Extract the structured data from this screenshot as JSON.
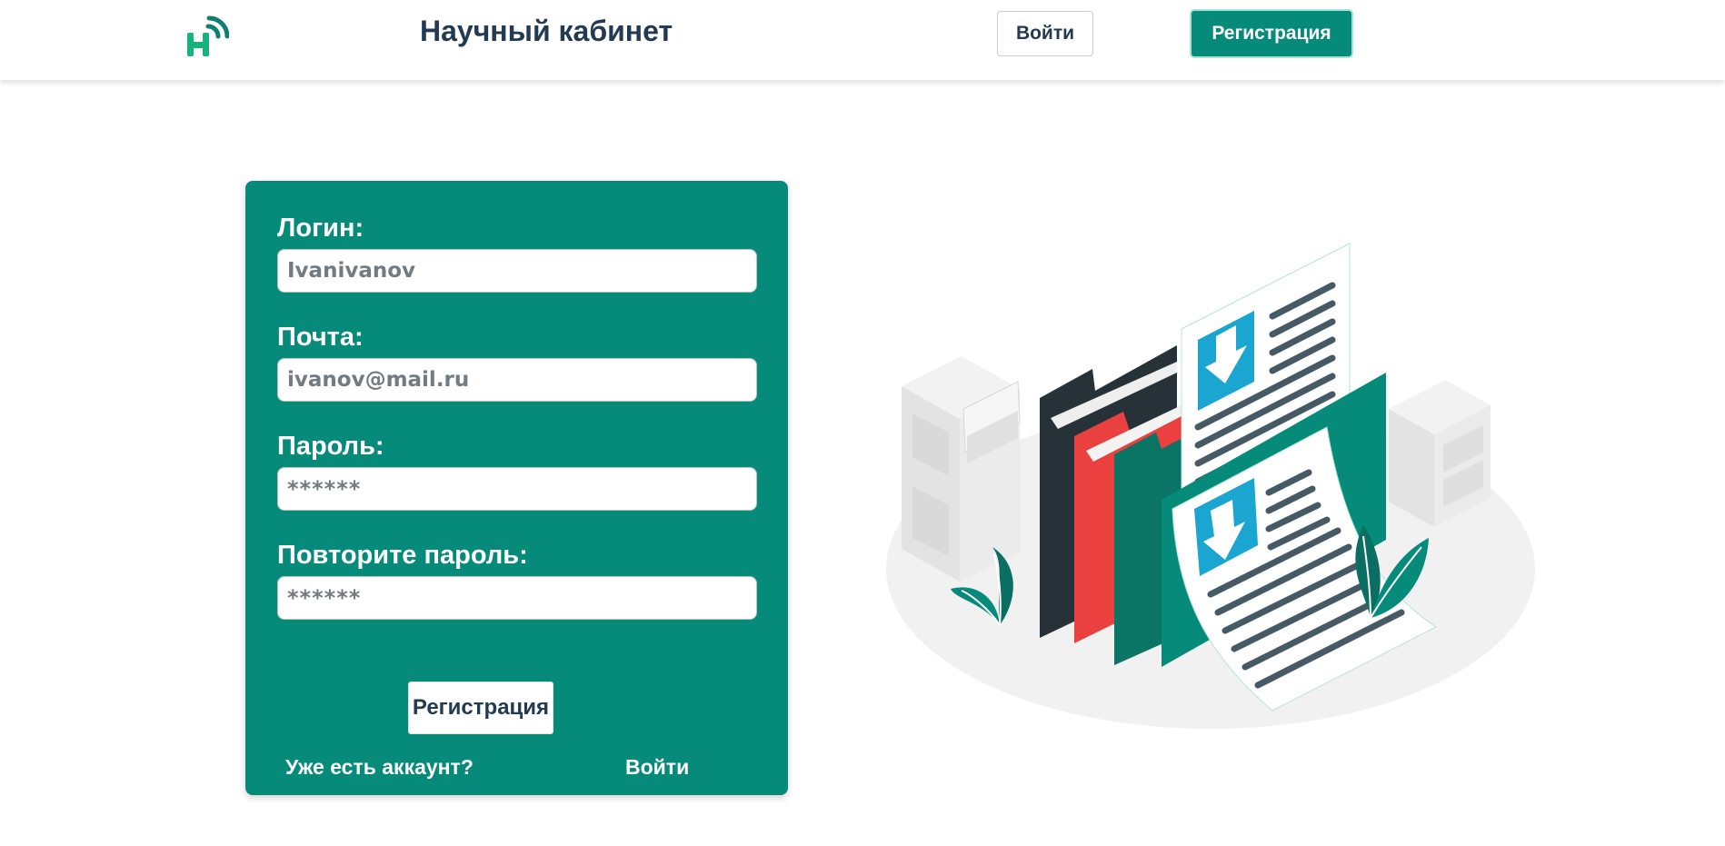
{
  "header": {
    "title": "Научный кабинет",
    "login_label": "Войти",
    "register_label": "Регистрация"
  },
  "form": {
    "login": {
      "label": "Логин:",
      "value": "Ivanivanov"
    },
    "email": {
      "label": "Почта:",
      "value": "ivanov@mail.ru"
    },
    "password": {
      "label": "Пароль:",
      "value": "******"
    },
    "password_repeat": {
      "label": "Повторите пароль:",
      "value": "******"
    },
    "submit_label": "Регистрация",
    "have_account_text": "Уже есть аккаунт?",
    "login_link_label": "Войти"
  },
  "colors": {
    "brand_teal": "#068a79",
    "title_navy": "#223a52",
    "input_text": "#727a82",
    "accent_red": "#ea4040",
    "accent_blue": "#1aa6d1"
  },
  "illustration": {
    "icon": "documents-folders-illustration"
  }
}
